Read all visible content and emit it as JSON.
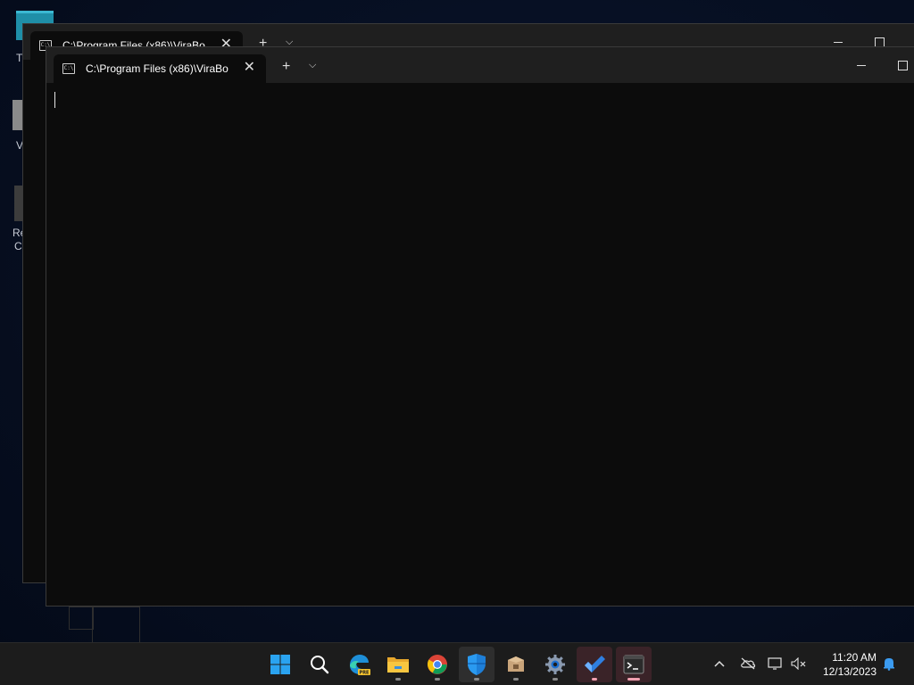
{
  "desktop": {
    "labels": [
      "T",
      "V",
      "Re",
      "C"
    ]
  },
  "back_window": {
    "tab_title": "C:\\Program Files (x86)\\ViraBo",
    "tab_icon_text": "C:\\"
  },
  "front_window": {
    "tab_title": "C:\\Program Files (x86)\\ViraBo",
    "tab_icon_text": "C:\\"
  },
  "taskbar": {
    "apps": [
      {
        "name": "start-button",
        "icon": "windows-logo-icon"
      },
      {
        "name": "search-button",
        "icon": "search-icon"
      },
      {
        "name": "edge-preview",
        "icon": "edge-icon",
        "badge": "PRE"
      },
      {
        "name": "file-explorer",
        "icon": "folder-icon"
      },
      {
        "name": "chrome",
        "icon": "chrome-icon"
      },
      {
        "name": "windows-security",
        "icon": "shield-icon"
      },
      {
        "name": "package-app",
        "icon": "box-icon"
      },
      {
        "name": "settings",
        "icon": "gear-icon"
      },
      {
        "name": "todo",
        "icon": "checkmark-icon"
      },
      {
        "name": "terminal",
        "icon": "terminal-icon"
      }
    ],
    "clock": {
      "time": "11:20 AM",
      "date": "12/13/2023"
    }
  }
}
